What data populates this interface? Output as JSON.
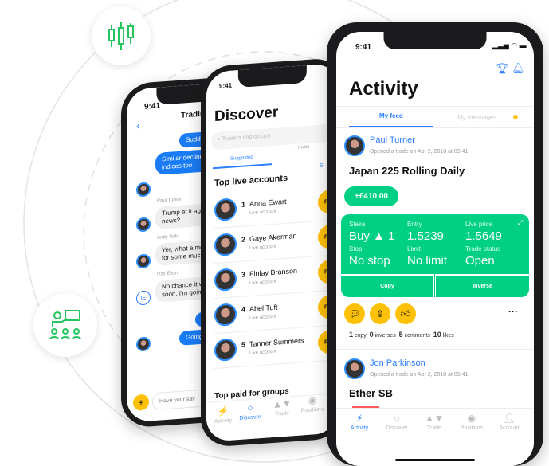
{
  "colors": {
    "accent": "#2b7fff",
    "green": "#00d084",
    "yellow": "#ffc107",
    "decor_green": "#22c55e"
  },
  "decor_icons": [
    "candlestick-chart-icon",
    "presentation-group-icon"
  ],
  "status_time": "9:41",
  "chat": {
    "title": "Tradin",
    "messages": [
      {
        "from": "me",
        "text": "Sudden"
      },
      {
        "from": "me",
        "text": "Similar declines\nindices too"
      },
      {
        "from": "Paul Turner",
        "text": "Trump at it agai\nnews?"
      },
      {
        "from": "Andy Nab",
        "text": "Yer, what a mess\nfor some much"
      },
      {
        "from": "Izzy Elton",
        "initials": "IE",
        "text": "No chance it will\nsoon. I'm going"
      },
      {
        "from": "me",
        "text": "He"
      },
      {
        "from": "me",
        "text": "Going"
      }
    ],
    "input_placeholder": "Have your say"
  },
  "discover": {
    "title": "Discover",
    "search_placeholder": "Traders and groups",
    "tabs": [
      "Suggested",
      "Invite"
    ],
    "see_all": "S",
    "section": "Top live accounts",
    "accounts": [
      {
        "rank": "1",
        "name": "Anna Ewart",
        "sub": "Live account"
      },
      {
        "rank": "2",
        "name": "Gaye Akerman",
        "sub": "Live account"
      },
      {
        "rank": "3",
        "name": "Finlay Branson",
        "sub": "Live account"
      },
      {
        "rank": "4",
        "name": "Abel Tuft",
        "sub": "Live account"
      },
      {
        "rank": "5",
        "name": "Tanner Summers",
        "sub": "Live account"
      }
    ],
    "follow_label": "Fo",
    "section2": "Top paid for groups",
    "nav": [
      "Activity",
      "Discover",
      "Trade",
      "Positions"
    ]
  },
  "activity": {
    "title": "Activity",
    "tabs": [
      "My feed",
      "My messages"
    ],
    "post1": {
      "name": "Paul Turner",
      "sub": "Opened a trade on Apr 2, 2018 at 09:41",
      "market": "Japan 225 Rolling Daily",
      "pnl": "+£410.00",
      "stake_label": "Stake",
      "stake": "Buy ▲ 1",
      "entry_label": "Entry",
      "entry": "1.5239",
      "live_label": "Live price",
      "live": "1.5649",
      "stop_label": "Stop",
      "stop": "No stop",
      "limit_label": "Limit",
      "limit": "No limit",
      "status_label": "Trade status",
      "status": "Open",
      "copy": "Copy",
      "inverse": "Inverse",
      "counts": [
        {
          "n": "1",
          "l": "copy"
        },
        {
          "n": "0",
          "l": "inverses"
        },
        {
          "n": "5",
          "l": "comments"
        },
        {
          "n": "10",
          "l": "likes"
        }
      ]
    },
    "post2": {
      "name": "Jon Parkinson",
      "sub": "Opened a trade on Apr 2, 2018 at 09:41",
      "market": "Ether SB"
    },
    "nav": [
      "Activity",
      "Discover",
      "Trade",
      "Positions",
      "Account"
    ]
  }
}
